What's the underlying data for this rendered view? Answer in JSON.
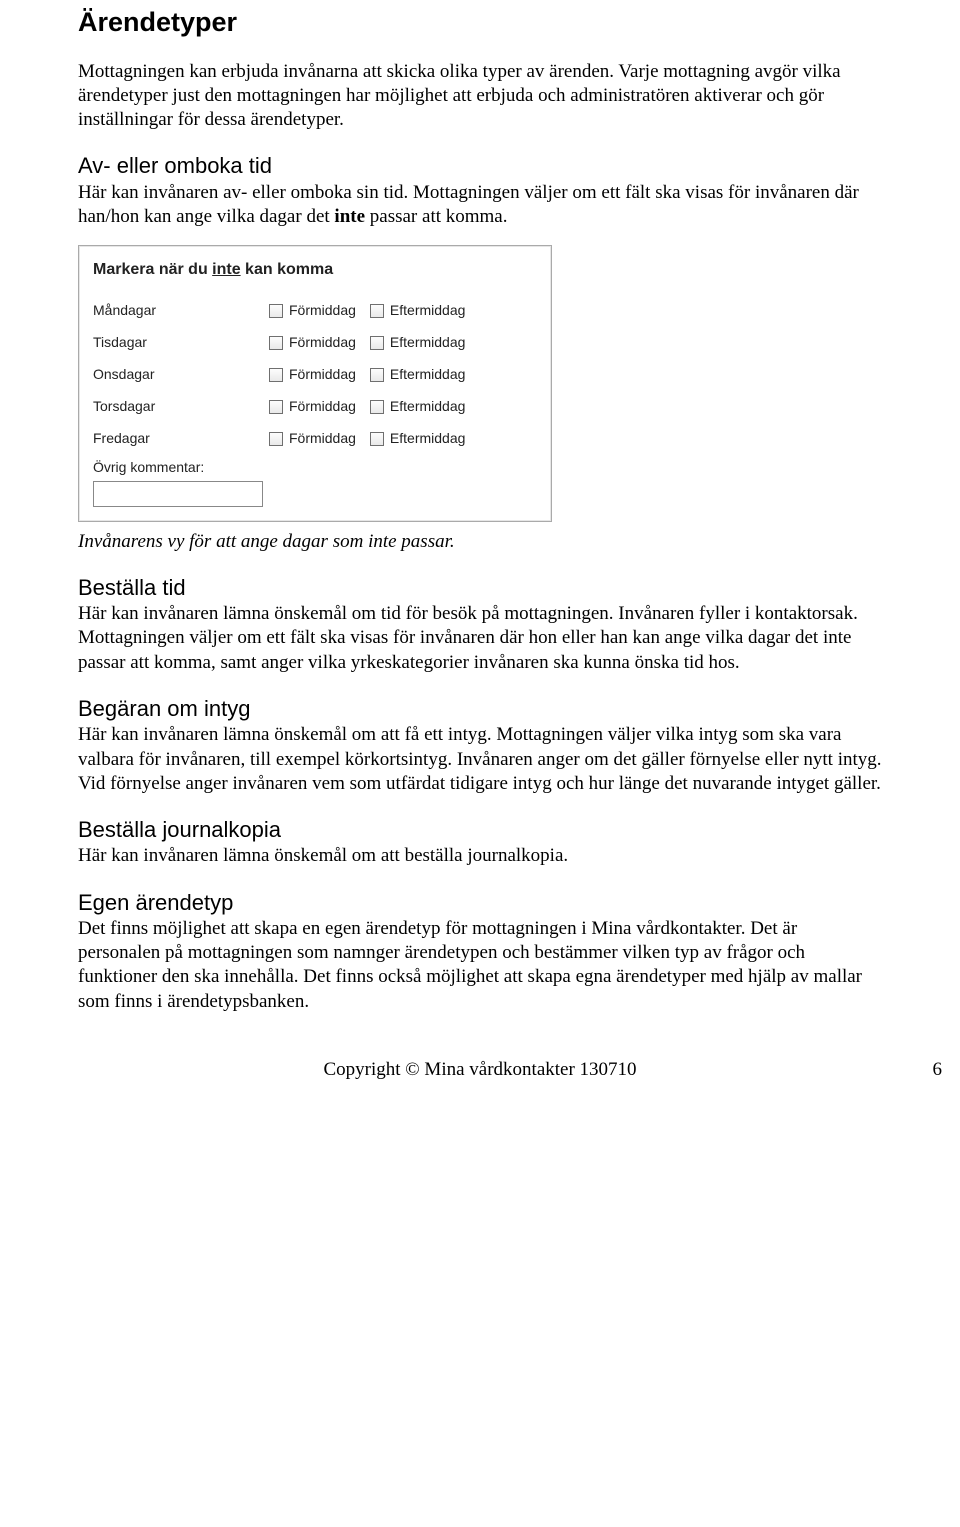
{
  "title": "Ärendetyper",
  "intro": "Mottagningen kan erbjuda invånarna att skicka olika typer av ärenden. Varje mottagning avgör vilka ärendetyper just den mottagningen har möjlighet att erbjuda och administratören aktiverar och gör inställningar för dessa ärendetyper.",
  "sections": {
    "avboka": {
      "heading": "Av- eller omboka tid",
      "body_a": "Här kan invånaren av- eller omboka sin tid. Mottagningen väljer om ett fält ska visas för invånaren där han/hon kan ange vilka dagar det ",
      "body_bold": "inte",
      "body_b": " passar att komma."
    },
    "bestalla": {
      "heading": "Beställa tid",
      "body": "Här kan invånaren lämna önskemål om tid för besök på mottagningen. Invånaren fyller i kontaktorsak. Mottagningen väljer om ett fält ska visas för invånaren där hon eller han kan ange vilka dagar det inte passar att komma, samt anger vilka yrkeskategorier invånaren ska kunna önska tid hos."
    },
    "begaran": {
      "heading": "Begäran om intyg",
      "body": "Här kan invånaren lämna önskemål om att få ett intyg. Mottagningen väljer vilka intyg som ska vara valbara för invånaren, till exempel körkortsintyg. Invånaren anger om det gäller förnyelse eller nytt intyg. Vid förnyelse anger invånaren vem som utfärdat tidigare intyg och hur länge det nuvarande intyget gäller."
    },
    "journal": {
      "heading": "Beställa journalkopia",
      "body": "Här kan invånaren lämna önskemål om att beställa journalkopia."
    },
    "egen": {
      "heading": "Egen ärendetyp",
      "body": "Det finns möjlighet att skapa en egen ärendetyp för mottagningen i Mina vårdkontakter. Det är personalen på mottagningen som namnger ärendetypen och bestämmer vilken typ av frågor och funktioner den ska innehålla. Det finns också möjlighet att skapa egna ärendetyper med hjälp av mallar som finns i ärendetypsbanken."
    }
  },
  "form": {
    "title_a": "Markera när du ",
    "title_u": "inte",
    "title_b": " kan komma",
    "days": [
      "Måndagar",
      "Tisdagar",
      "Onsdagar",
      "Torsdagar",
      "Fredagar"
    ],
    "am": "Förmiddag",
    "pm": "Eftermiddag",
    "comment_label": "Övrig kommentar:",
    "comment_value": ""
  },
  "caption": "Invånarens vy för att ange dagar som inte passar.",
  "footer": "Copyright © Mina vårdkontakter 130710",
  "page": "6"
}
